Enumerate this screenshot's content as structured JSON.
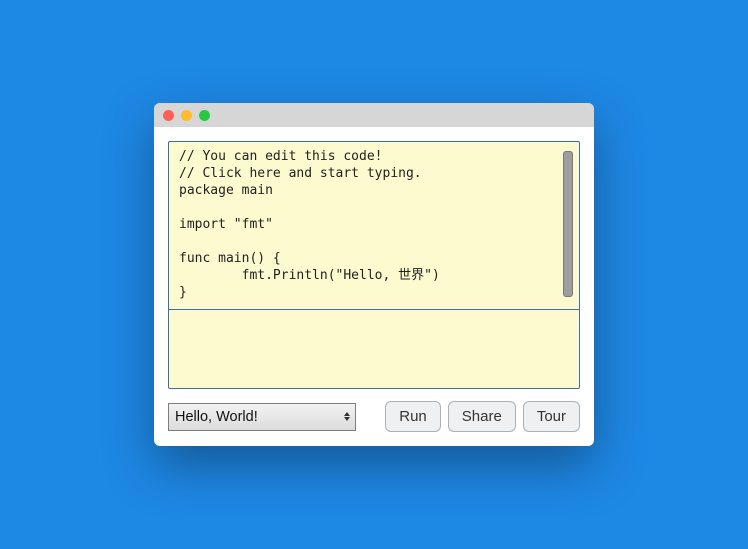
{
  "editor": {
    "code": "// You can edit this code!\n// Click here and start typing.\npackage main\n\nimport \"fmt\"\n\nfunc main() {\n        fmt.Println(\"Hello, 世界\")\n}"
  },
  "output": {
    "text": ""
  },
  "controls": {
    "example_selected": "Hello, World!",
    "run_label": "Run",
    "share_label": "Share",
    "tour_label": "Tour"
  }
}
